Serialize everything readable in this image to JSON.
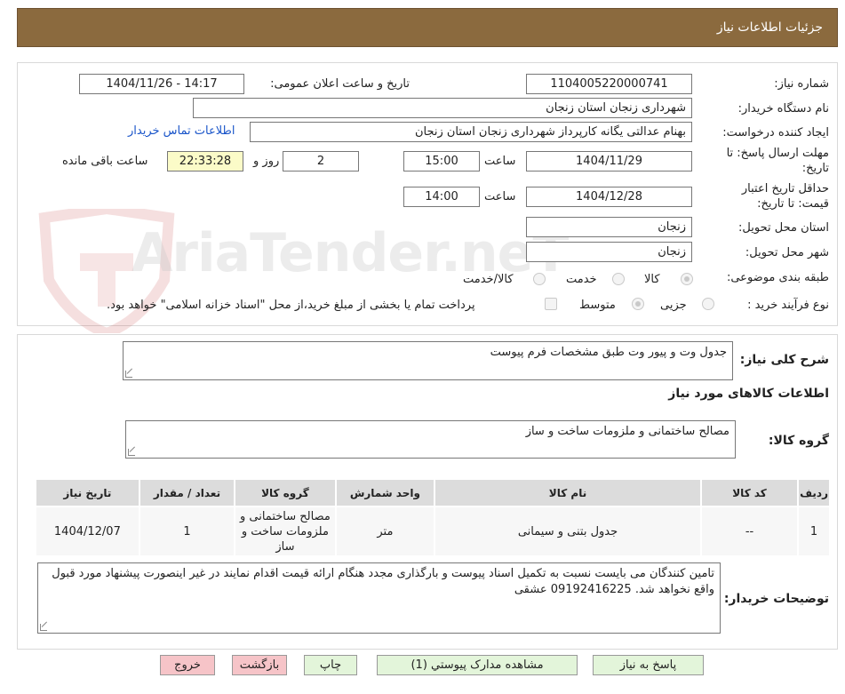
{
  "header": {
    "title": "جزئیات اطلاعات نیاز"
  },
  "form": {
    "need_number_label": "شماره نیاز:",
    "need_number": "1104005220000741",
    "announce_label": "تاریخ و ساعت اعلان عمومی:",
    "announce_value": "1404/11/26 - 14:17",
    "buyer_org_label": "نام دستگاه خریدار:",
    "buyer_org": "شهرداری زنجان استان زنجان",
    "creator_label": "ایجاد کننده درخواست:",
    "creator": "بهنام عدالتی یگانه کارپرداز شهرداری زنجان استان زنجان",
    "contact_link": "اطلاعات تماس خریدار",
    "deadline_label_1": "مهلت ارسال پاسخ: تا",
    "deadline_label_2": "تاریخ:",
    "deadline_date": "1404/11/29",
    "time_label": "ساعت",
    "deadline_time": "15:00",
    "days_value": "2",
    "days_label": "روز و",
    "remaining_time": "22:33:28",
    "remaining_label": "ساعت باقی مانده",
    "validity_label_1": "حداقل تاریخ اعتبار",
    "validity_label_2": "قیمت: تا تاریخ:",
    "validity_date": "1404/12/28",
    "validity_time_label": "ساعت",
    "validity_time": "14:00",
    "province_label": "استان محل تحویل:",
    "province": "زنجان",
    "city_label": "شهر محل تحویل:",
    "city": "زنجان",
    "category_label": "طبقه بندی موضوعی:",
    "category_options": [
      "کالا",
      "خدمت",
      "کالا/خدمت"
    ],
    "process_label": "نوع فرآیند خرید :",
    "process_options": [
      "جزیی",
      "متوسط"
    ],
    "payment_note": "پرداخت تمام یا بخشی از مبلغ خرید،از محل \"اسناد خزانه اسلامی\" خواهد بود."
  },
  "watermark": "AriaTender.neT",
  "details": {
    "summary_label": "شرح کلی نیاز:",
    "summary": "جدول وت و پیور وت طبق مشخصات فرم پیوست",
    "goods_info_title": "اطلاعات کالاهای مورد نیاز",
    "goods_group_label": "گروه کالا:",
    "goods_group": "مصالح ساختمانی و ملزومات ساخت و ساز",
    "table": {
      "headers": [
        "ردیف",
        "کد کالا",
        "نام کالا",
        "واحد شمارش",
        "گروه کالا",
        "تعداد / مقدار",
        "تاریخ نیاز"
      ],
      "rows": [
        [
          "1",
          "--",
          "جدول بتنی و سیمانی",
          "متر",
          "مصالح ساختمانی و ملزومات ساخت و ساز",
          "1",
          "1404/12/07"
        ]
      ]
    },
    "buyer_notes_label": "توضیحات خریدار:",
    "buyer_notes": "تامین کنندگان می بایست نسبت به تکمیل اسناد پیوست و بارگذاری مجدد هنگام ارائه قیمت اقدام نمایند در غیر اینصورت پیشنهاد مورد قبول واقع نخواهد شد. 09192416225 عشقی"
  },
  "buttons": {
    "reply": "پاسخ به نیاز",
    "attachments": "مشاهده مدارک پیوستي (1)",
    "print": "چاپ",
    "back": "بازگشت",
    "exit": "خروج"
  }
}
